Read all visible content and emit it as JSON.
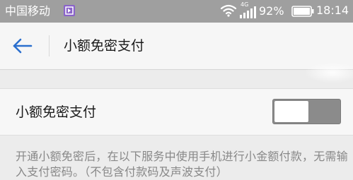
{
  "status_bar": {
    "carrier": "中国移动",
    "carrier_badge_icon": "carrier-app-icon",
    "wifi_icon": "wifi-icon",
    "network_type": "4G",
    "signal_icon": "signal-icon",
    "battery_percent": "92%",
    "battery_icon": "battery-icon",
    "time": "18:14"
  },
  "header": {
    "back_icon": "back-arrow-icon",
    "title": "小额免密支付"
  },
  "setting": {
    "label": "小额免密支付",
    "toggle_state": "off"
  },
  "description": "开通小额免密后，在以下服务中使用手机进行小金额付款，无需输入支付密码。（不包含付款码及声波支付）",
  "colors": {
    "status_bar_bg": "#9f9f9f",
    "accent": "#2b6fce",
    "toggle_off": "#8b8b8b",
    "description_text": "#888888"
  }
}
